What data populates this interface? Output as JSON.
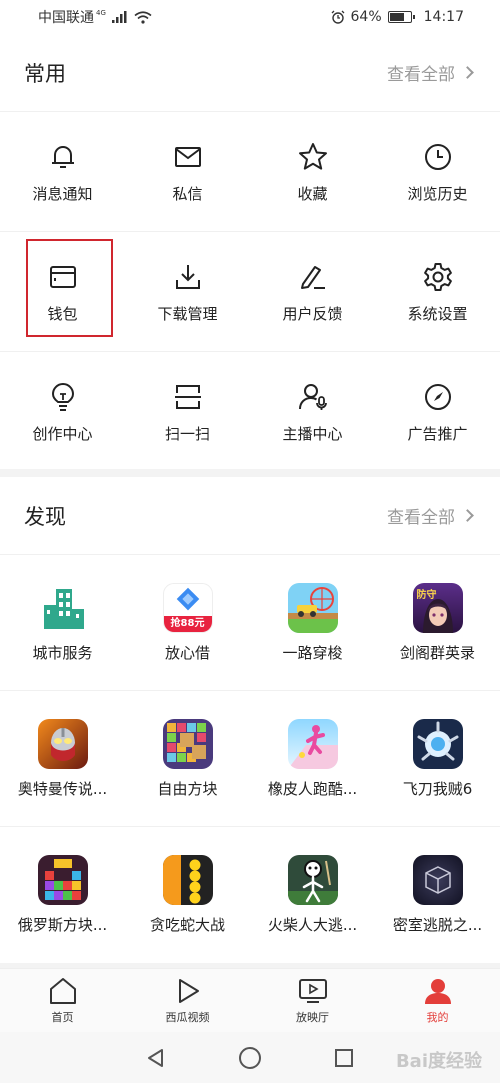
{
  "status_bar": {
    "carrier": "中国联通",
    "network": "4G",
    "battery": "64%",
    "battery_level": 0.64,
    "time": "14:17"
  },
  "common": {
    "title": "常用",
    "see_all": "查看全部",
    "items": [
      {
        "label": "消息通知",
        "icon": "bell-icon"
      },
      {
        "label": "私信",
        "icon": "mail-icon"
      },
      {
        "label": "收藏",
        "icon": "star-icon"
      },
      {
        "label": "浏览历史",
        "icon": "clock-icon"
      },
      {
        "label": "钱包",
        "icon": "wallet-icon"
      },
      {
        "label": "下载管理",
        "icon": "download-icon"
      },
      {
        "label": "用户反馈",
        "icon": "feedback-pen-icon"
      },
      {
        "label": "系统设置",
        "icon": "gear-icon"
      },
      {
        "label": "创作中心",
        "icon": "lightbulb-icon"
      },
      {
        "label": "扫一扫",
        "icon": "scan-icon"
      },
      {
        "label": "主播中心",
        "icon": "streamer-icon"
      },
      {
        "label": "广告推广",
        "icon": "compass-icon"
      }
    ]
  },
  "discover": {
    "title": "发现",
    "see_all": "查看全部",
    "items": [
      {
        "label": "城市服务",
        "icon": "city-buildings-icon"
      },
      {
        "label": "放心借",
        "icon": "loan-app-icon",
        "badge": "抢88元"
      },
      {
        "label": "一路穿梭",
        "icon": "racing-game-icon"
      },
      {
        "label": "剑阁群英录",
        "icon": "anime-game-icon",
        "badge": "防守"
      },
      {
        "label": "奥特曼传说...",
        "icon": "ultraman-game-icon"
      },
      {
        "label": "自由方块",
        "icon": "block-puzzle-icon"
      },
      {
        "label": "橡皮人跑酷...",
        "icon": "runner-game-icon"
      },
      {
        "label": "飞刀我贼6",
        "icon": "knife-game-icon"
      },
      {
        "label": "俄罗斯方块...",
        "icon": "tetris-game-icon"
      },
      {
        "label": "贪吃蛇大战",
        "icon": "snake-game-icon"
      },
      {
        "label": "火柴人大逃...",
        "icon": "stickman-game-icon"
      },
      {
        "label": "密室逃脱之...",
        "icon": "cube-escape-icon"
      }
    ]
  },
  "tabs": [
    {
      "label": "首页",
      "icon": "home-icon"
    },
    {
      "label": "西瓜视频",
      "icon": "play-icon"
    },
    {
      "label": "放映厅",
      "icon": "tv-play-icon"
    },
    {
      "label": "我的",
      "icon": "user-icon",
      "active": true
    }
  ],
  "nav": [
    "back-triangle-icon",
    "home-circle-icon",
    "recents-square-icon"
  ],
  "watermark": "Bai度经验",
  "colors": {
    "accent": "#e33e3a",
    "highlight_box": "#d0262e",
    "secondary_text": "#9a9a9a"
  }
}
